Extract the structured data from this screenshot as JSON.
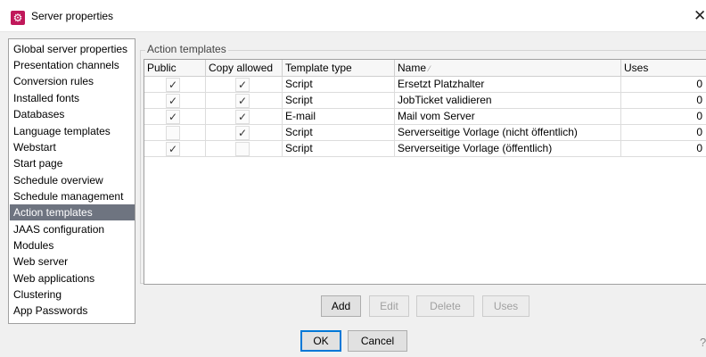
{
  "window": {
    "title": "Server properties",
    "app_icon": "gear-icon",
    "close_glyph": "✕"
  },
  "sidebar": {
    "selected_index": 12,
    "items": [
      {
        "label": "Global server properties"
      },
      {
        "label": "Presentation channels"
      },
      {
        "label": "Conversion rules"
      },
      {
        "label": "Installed fonts"
      },
      {
        "label": "Databases"
      },
      {
        "label": "Language templates"
      },
      {
        "label": "Webstart"
      },
      {
        "label": "Start page"
      },
      {
        "label": "Schedule overview"
      },
      {
        "label": "Schedule management"
      },
      {
        "label": "Action templates"
      },
      {
        "label": "JAAS configuration"
      },
      {
        "label": "Modules"
      },
      {
        "label": "Web server"
      },
      {
        "label": "Web applications"
      },
      {
        "label": "Clustering"
      },
      {
        "label": "App Passwords"
      }
    ]
  },
  "panel": {
    "group_label": "Action templates",
    "columns": {
      "public": "Public",
      "copy_allowed": "Copy allowed",
      "template_type": "Template type",
      "name": "Name",
      "uses": "Uses"
    },
    "sort_indicator": "⁄",
    "rows": [
      {
        "public": true,
        "copy_allowed": true,
        "type": "Script",
        "name": "Ersetzt Platzhalter",
        "uses": "0"
      },
      {
        "public": true,
        "copy_allowed": true,
        "type": "Script",
        "name": "JobTicket validieren",
        "uses": "0"
      },
      {
        "public": true,
        "copy_allowed": true,
        "type": "E-mail",
        "name": "Mail vom Server",
        "uses": "0"
      },
      {
        "public": false,
        "copy_allowed": true,
        "type": "Script",
        "name": "Serverseitige Vorlage (nicht öffentlich)",
        "uses": "0"
      },
      {
        "public": true,
        "copy_allowed": false,
        "type": "Script",
        "name": "Serverseitige Vorlage (öffentlich)",
        "uses": "0"
      }
    ],
    "check_glyph": "✓",
    "buttons": {
      "add": "Add",
      "edit": "Edit",
      "delete": "Delete",
      "uses": "Uses"
    }
  },
  "footer": {
    "ok": "OK",
    "cancel": "Cancel",
    "help_glyph": "?"
  }
}
